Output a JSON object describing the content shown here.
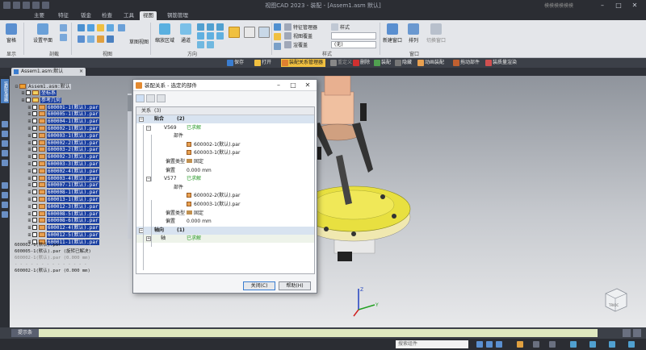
{
  "titlebar": {
    "title": "视图CAD 2023 - 装配 - [Assem1.asm 默认]",
    "right_text": "模模模模模模"
  },
  "ribbon_tabs": [
    "主要",
    "特征",
    "钣金",
    "检查",
    "工具",
    "视图",
    "钢筋管理"
  ],
  "ribbon": {
    "btn_window": "窗格",
    "btn_section": "设置平面",
    "btn_slice_view": "草图视图",
    "btn_zoom_area": "缩放区域",
    "btn_pass": "通道",
    "item_feature_mgr": "特征管理器",
    "item_view_overlay": "视图覆盖",
    "item_render": "渲覆盖",
    "item_style": "样式",
    "combo_none": "(无)",
    "btn_new_window": "新建窗口",
    "btn_arrange": "排列",
    "btn_unload": "切换窗口",
    "groups": {
      "display": "显示",
      "section": "剖截",
      "view": "视图",
      "direction": "方向",
      "style": "样式",
      "window": "窗口"
    }
  },
  "commands": [
    {
      "label": "保存",
      "color": "#3a7dd0"
    },
    {
      "label": "打开",
      "color": "#f0c040"
    },
    {
      "label": "装配关系管理器",
      "color": "#e08030",
      "selected": true
    },
    {
      "label": "重定义",
      "color": "#888888"
    },
    {
      "label": "删除",
      "color": "#d03030"
    },
    {
      "label": "装配",
      "color": "#50a050"
    },
    {
      "label": "隐藏",
      "color": "#777777"
    },
    {
      "label": "动画装配",
      "color": "#e8a050"
    },
    {
      "label": "拖动部件",
      "color": "#c06030"
    },
    {
      "label": "装质量渲染",
      "color": "#d05050"
    }
  ],
  "doc_tab": "Assem1.asm:默认",
  "sidebar_tab": "装配管理器",
  "tree": {
    "root": "Assem1.asm:默认",
    "items": [
      {
        "label": "坐标系",
        "kind": "folder"
      },
      {
        "label": "参考几何",
        "kind": "folder"
      },
      {
        "label": "600001-1(默认).par"
      },
      {
        "label": "600005-1(默认).par"
      },
      {
        "label": "600004-1(默认).par"
      },
      {
        "label": "600002-1(默认).par"
      },
      {
        "label": "600003-1(默认).par"
      },
      {
        "label": "600002-2(默认).par"
      },
      {
        "label": "600003-2(默认).par"
      },
      {
        "label": "600002-3(默认).par"
      },
      {
        "label": "600003-3(默认).par"
      },
      {
        "label": "600002-4(默认).par"
      },
      {
        "label": "600003-4(默认).par"
      },
      {
        "label": "600007-1(默认).par"
      },
      {
        "label": "600008-1(默认).par"
      },
      {
        "label": "600013-1(默认).par"
      },
      {
        "label": "600012-3(默认).par"
      },
      {
        "label": "600008-5(默认).par"
      },
      {
        "label": "600008-6(默认).par"
      },
      {
        "label": "600012-4(默认).par"
      },
      {
        "label": "600012-5(默认).par"
      },
      {
        "label": "600011-1(默认).par"
      }
    ]
  },
  "mates": [
    {
      "label": "600002-1(默认).par",
      "grey": false
    },
    {
      "label": "600005-1(默认).par   (旋转已解决)",
      "grey": false
    },
    {
      "label": "600002-1(默认).par   (0.000 mm)",
      "grey": true
    },
    {
      "label": "- - - - - - - - - - - - - -",
      "grey": true
    },
    {
      "label": "600002-1(默认).par   (0.000 mm)",
      "grey": false
    }
  ],
  "dialog": {
    "title": "装配关系 - 选定的部件",
    "col_relation": "关系",
    "col_count": "(3)",
    "rows": [
      {
        "type": "group",
        "label": "贴合",
        "count": "(2)"
      },
      {
        "type": "mate",
        "label": "V569",
        "status": "已求解"
      },
      {
        "type": "field",
        "label": "部件"
      },
      {
        "type": "part",
        "label": "600002-1(默认).par"
      },
      {
        "type": "part",
        "label": "600003-1(默认).par"
      },
      {
        "type": "prop",
        "label": "偏置类型",
        "value": "固定"
      },
      {
        "type": "prop",
        "label": "偏置",
        "value": "0.000 mm"
      },
      {
        "type": "mate",
        "label": "V577",
        "status": "已求解"
      },
      {
        "type": "field",
        "label": "部件"
      },
      {
        "type": "part",
        "label": "600002-2(默认).par"
      },
      {
        "type": "part",
        "label": "600003-1(默认).par"
      },
      {
        "type": "prop",
        "label": "偏置类型",
        "value": "固定"
      },
      {
        "type": "prop",
        "label": "偏置",
        "value": "0.000 mm"
      },
      {
        "type": "group",
        "label": "轴向",
        "count": "(1)"
      },
      {
        "type": "axis",
        "label": "轴",
        "status": "已求解"
      }
    ],
    "btn_close": "关闭(C)",
    "btn_help": "帮助(H)"
  },
  "viewcube_label": "TRIOC",
  "prompt_label": "提示条",
  "search_placeholder": "搜索组件"
}
